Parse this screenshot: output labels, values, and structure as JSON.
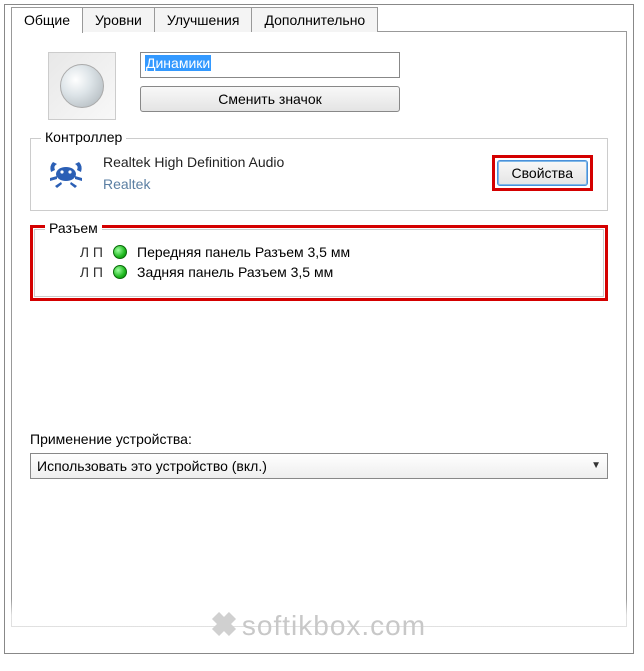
{
  "tabs": {
    "general": "Общие",
    "levels": "Уровни",
    "enhancements": "Улучшения",
    "advanced": "Дополнительно"
  },
  "device": {
    "name": "Динамики",
    "change_icon_btn": "Сменить значок"
  },
  "controller": {
    "group_title": "Контроллер",
    "name": "Realtek High Definition Audio",
    "vendor": "Realtek",
    "properties_btn": "Свойства"
  },
  "jack": {
    "group_title": "Разъем",
    "rows": [
      {
        "lr": "Л П",
        "label": "Передняя панель Разъем 3,5 мм"
      },
      {
        "lr": "Л П",
        "label": "Задняя панель Разъем 3,5 мм"
      }
    ]
  },
  "usage": {
    "label": "Применение устройства:",
    "selected": "Использовать это устройство (вкл.)"
  },
  "watermark": "softikbox.com"
}
